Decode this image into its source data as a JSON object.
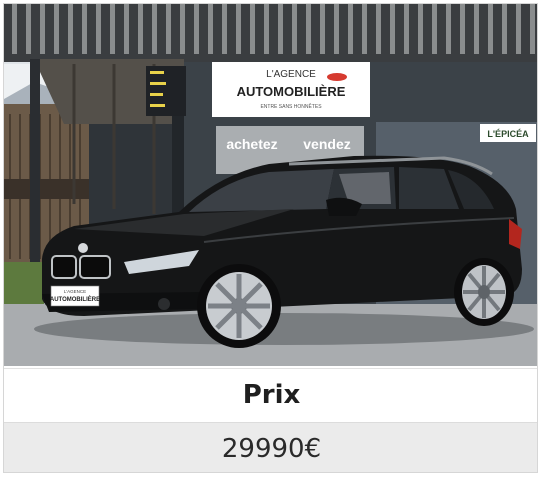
{
  "listing": {
    "price_label": "Prix",
    "price_value": "29990€"
  },
  "photo": {
    "sign_agency_top": "L'AGENCE",
    "sign_agency_main": "AUTOMOBILIÈRE",
    "sign_agency_tagline": "ENTRE SANS HONNÊTES",
    "banner_left": "achetez",
    "banner_right": "vendez",
    "shop_sign": "L'ÉPICÉA",
    "plate_top": "L'AGENCE",
    "plate_main": "AUTOMOBILIÈRE"
  }
}
